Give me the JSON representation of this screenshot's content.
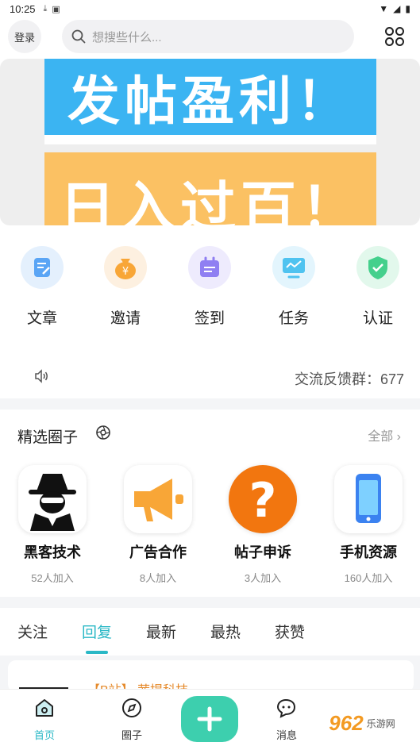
{
  "status": {
    "time": "10:25"
  },
  "header": {
    "login_label": "登录",
    "search_placeholder": "想搜些什么..."
  },
  "banner": {
    "line1": "发帖盈利！",
    "line2": "日入过百！"
  },
  "quick_actions": [
    {
      "label": "文章",
      "icon": "article-icon",
      "color": "#5aa5f5"
    },
    {
      "label": "邀请",
      "icon": "money-bag-icon",
      "color": "#f8a637"
    },
    {
      "label": "签到",
      "icon": "calendar-icon",
      "color": "#8f7ff2"
    },
    {
      "label": "任务",
      "icon": "monitor-icon",
      "color": "#4fc3f0"
    },
    {
      "label": "认证",
      "icon": "shield-check-icon",
      "color": "#44d08c"
    }
  ],
  "feedback": {
    "text": "交流反馈群：677"
  },
  "circles": {
    "title": "精选圈子",
    "all_label": "全部",
    "items": [
      {
        "name": "黑客技术",
        "count": "52人加入",
        "icon": "hacker-icon"
      },
      {
        "name": "广告合作",
        "count": "8人加入",
        "icon": "megaphone-icon"
      },
      {
        "name": "帖子申诉",
        "count": "3人加入",
        "icon": "question-icon"
      },
      {
        "name": "手机资源",
        "count": "160人加入",
        "icon": "phone-icon"
      }
    ]
  },
  "tabs": [
    {
      "label": "关注"
    },
    {
      "label": "回复"
    },
    {
      "label": "最新"
    },
    {
      "label": "最热"
    },
    {
      "label": "获赞"
    }
  ],
  "feed": {
    "first_title": "【B站】 茜提科技"
  },
  "bottom_nav": [
    {
      "label": "首页",
      "icon": "home-icon"
    },
    {
      "label": "圈子",
      "icon": "compass-icon"
    },
    {
      "label": "消息",
      "icon": "chat-icon"
    }
  ],
  "watermark": {
    "brand": "962",
    "suffix": "乐游网"
  },
  "colors": {
    "accent": "#2ab8c6",
    "fab": "#3dcfae"
  }
}
